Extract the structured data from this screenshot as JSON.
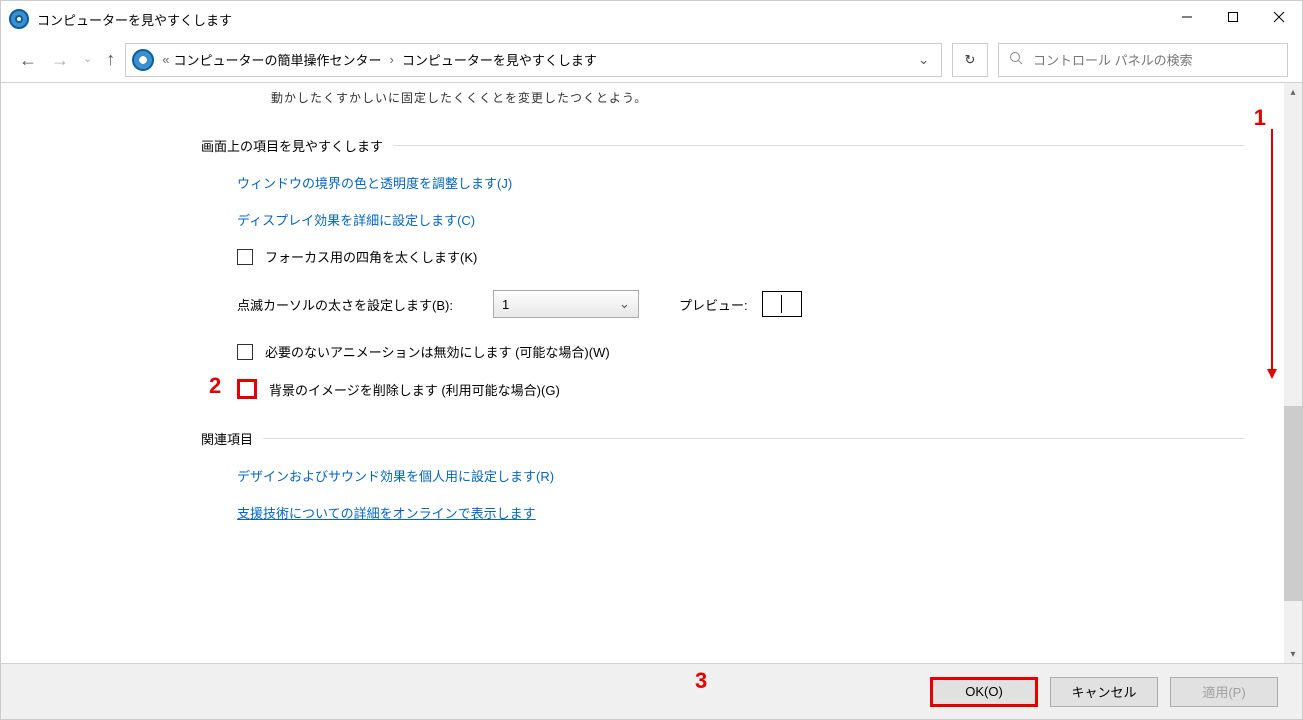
{
  "window": {
    "title": "コンピューターを見やすくします"
  },
  "breadcrumb": {
    "prefix": "«",
    "segment1": "コンピューターの簡単操作センター",
    "chevron": "›",
    "segment2": "コンピューターを見やすくします"
  },
  "search": {
    "placeholder": "コントロール パネルの検索"
  },
  "content": {
    "cut_text": "動かしたくすかしいに固定したくくくとを変更したつくとよう。",
    "section1": {
      "title": "画面上の項目を見やすくします",
      "link_window_border": "ウィンドウの境界の色と透明度を調整します(J)",
      "link_display_effects": "ディスプレイ効果を詳細に設定します(C)",
      "cb_focus_rect": "フォーカス用の四角を太くします(K)",
      "cursor_thickness_label": "点滅カーソルの太さを設定します(B):",
      "cursor_thickness_value": "1",
      "preview_label": "プレビュー:",
      "cb_disable_animations": "必要のないアニメーションは無効にします (可能な場合)(W)",
      "cb_remove_bg": "背景のイメージを削除します (利用可能な場合)(G)"
    },
    "section2": {
      "title": "関連項目",
      "link_personalize": "デザインおよびサウンド効果を個人用に設定します(R)",
      "link_assistive": "支援技術についての詳細をオンラインで表示します"
    }
  },
  "footer": {
    "ok": "OK(O)",
    "cancel": "キャンセル",
    "apply": "適用(P)"
  },
  "annotations": {
    "n1": "1",
    "n2": "2",
    "n3": "3"
  },
  "colors": {
    "highlight": "#e60000",
    "link": "#0066cc"
  }
}
